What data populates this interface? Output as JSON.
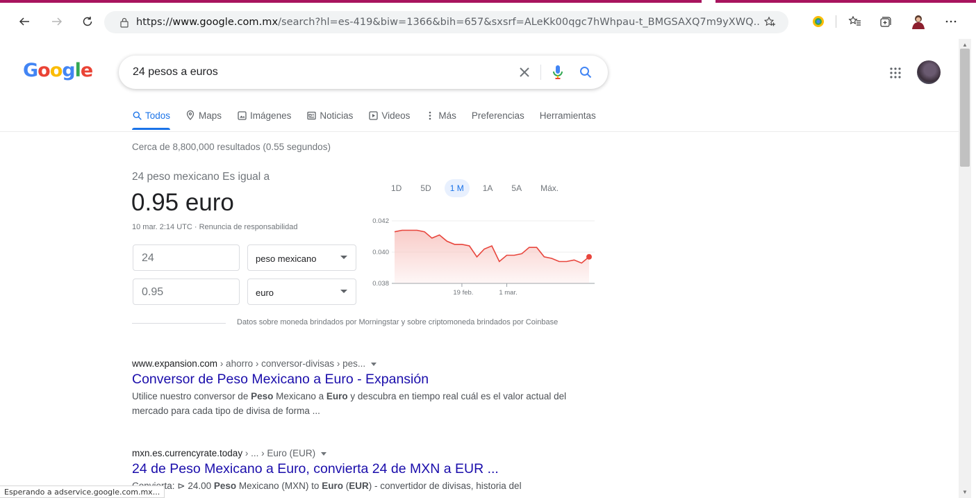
{
  "browser": {
    "url_scheme": "https://",
    "url_host": "www.google.com.mx",
    "url_rest": "/search?hl=es-419&biw=1366&bih=657&sxsrf=ALeKk00qgc7hWhpau-t_BMGSAXQ7m9yXWQ...",
    "back_icon": "arrow-left-icon",
    "forward_icon": "arrow-right-icon",
    "refresh_icon": "refresh-icon",
    "status_text": "Esperando a adservice.google.com.mx..."
  },
  "logo": {
    "letters": [
      "G",
      "o",
      "o",
      "g",
      "l",
      "e"
    ]
  },
  "search": {
    "query": "24 pesos a euros"
  },
  "tabs": [
    {
      "label": "Todos",
      "icon": "search-icon",
      "active": true
    },
    {
      "label": "Maps",
      "icon": "map-pin-icon"
    },
    {
      "label": "Imágenes",
      "icon": "image-icon"
    },
    {
      "label": "Noticias",
      "icon": "news-icon"
    },
    {
      "label": "Videos",
      "icon": "video-icon"
    },
    {
      "label": "Más",
      "icon": "more-vertical-icon"
    },
    {
      "label": "Preferencias"
    },
    {
      "label": "Herramientas"
    }
  ],
  "stats": "Cerca de 8,800,000 resultados (0.55 segundos)",
  "converter": {
    "equals_text": "24 peso mexicano Es igual a",
    "result": "0.95 euro",
    "date_text": "10 mar. 2:14 UTC · Renuncia de responsabilidad",
    "from_amount": "24",
    "from_currency": "peso mexicano",
    "to_amount": "0.95",
    "to_currency": "euro",
    "ranges": [
      "1D",
      "5D",
      "1 M",
      "1A",
      "5A",
      "Máx."
    ],
    "active_range": "1 M",
    "source": "Datos sobre moneda brindados por Morningstar y sobre criptomoneda brindados por Coinbase"
  },
  "chart_data": {
    "type": "area",
    "title": "",
    "xlabel": "",
    "ylabel": "",
    "ylim": [
      0.038,
      0.042
    ],
    "yticks": [
      "0.042",
      "0.040",
      "0.038"
    ],
    "xticks": [
      {
        "label": "19 feb.",
        "index": 9
      },
      {
        "label": "1 mar.",
        "index": 15
      }
    ],
    "values": [
      0.0413,
      0.0414,
      0.0414,
      0.0414,
      0.0413,
      0.0409,
      0.0411,
      0.0407,
      0.0405,
      0.0405,
      0.0404,
      0.0397,
      0.0402,
      0.0404,
      0.0394,
      0.0398,
      0.0398,
      0.0399,
      0.0403,
      0.0403,
      0.0397,
      0.0396,
      0.0394,
      0.0394,
      0.0395,
      0.0393,
      0.0397
    ],
    "line_color": "#e8453c",
    "fill_color": "#f8c9c5"
  },
  "results": [
    {
      "cite_host": "www.expansion.com",
      "cite_path": " › ahorro › conversor-divisas › pes...",
      "title": "Conversor de Peso Mexicano a Euro - Expansión",
      "snippet_parts": [
        {
          "t": "Utilice nuestro conversor de "
        },
        {
          "t": "Peso",
          "b": true
        },
        {
          "t": " Mexicano a "
        },
        {
          "t": "Euro",
          "b": true
        },
        {
          "t": " y descubra en tiempo real cuál es el valor actual del mercado para cada tipo de divisa de forma ..."
        }
      ]
    },
    {
      "cite_host": "mxn.es.currencyrate.today",
      "cite_path": " › ... › Euro (EUR)",
      "title": "24 de Peso Mexicano a Euro, convierta 24 de MXN a EUR ...",
      "snippet_parts": [
        {
          "t": "Convierta: ⊳ 24.00 "
        },
        {
          "t": "Peso",
          "b": true
        },
        {
          "t": " Mexicano (MXN) to "
        },
        {
          "t": "Euro",
          "b": true
        },
        {
          "t": " ("
        },
        {
          "t": "EUR",
          "b": true
        },
        {
          "t": ") - convertidor de divisas, historia del"
        }
      ]
    }
  ]
}
